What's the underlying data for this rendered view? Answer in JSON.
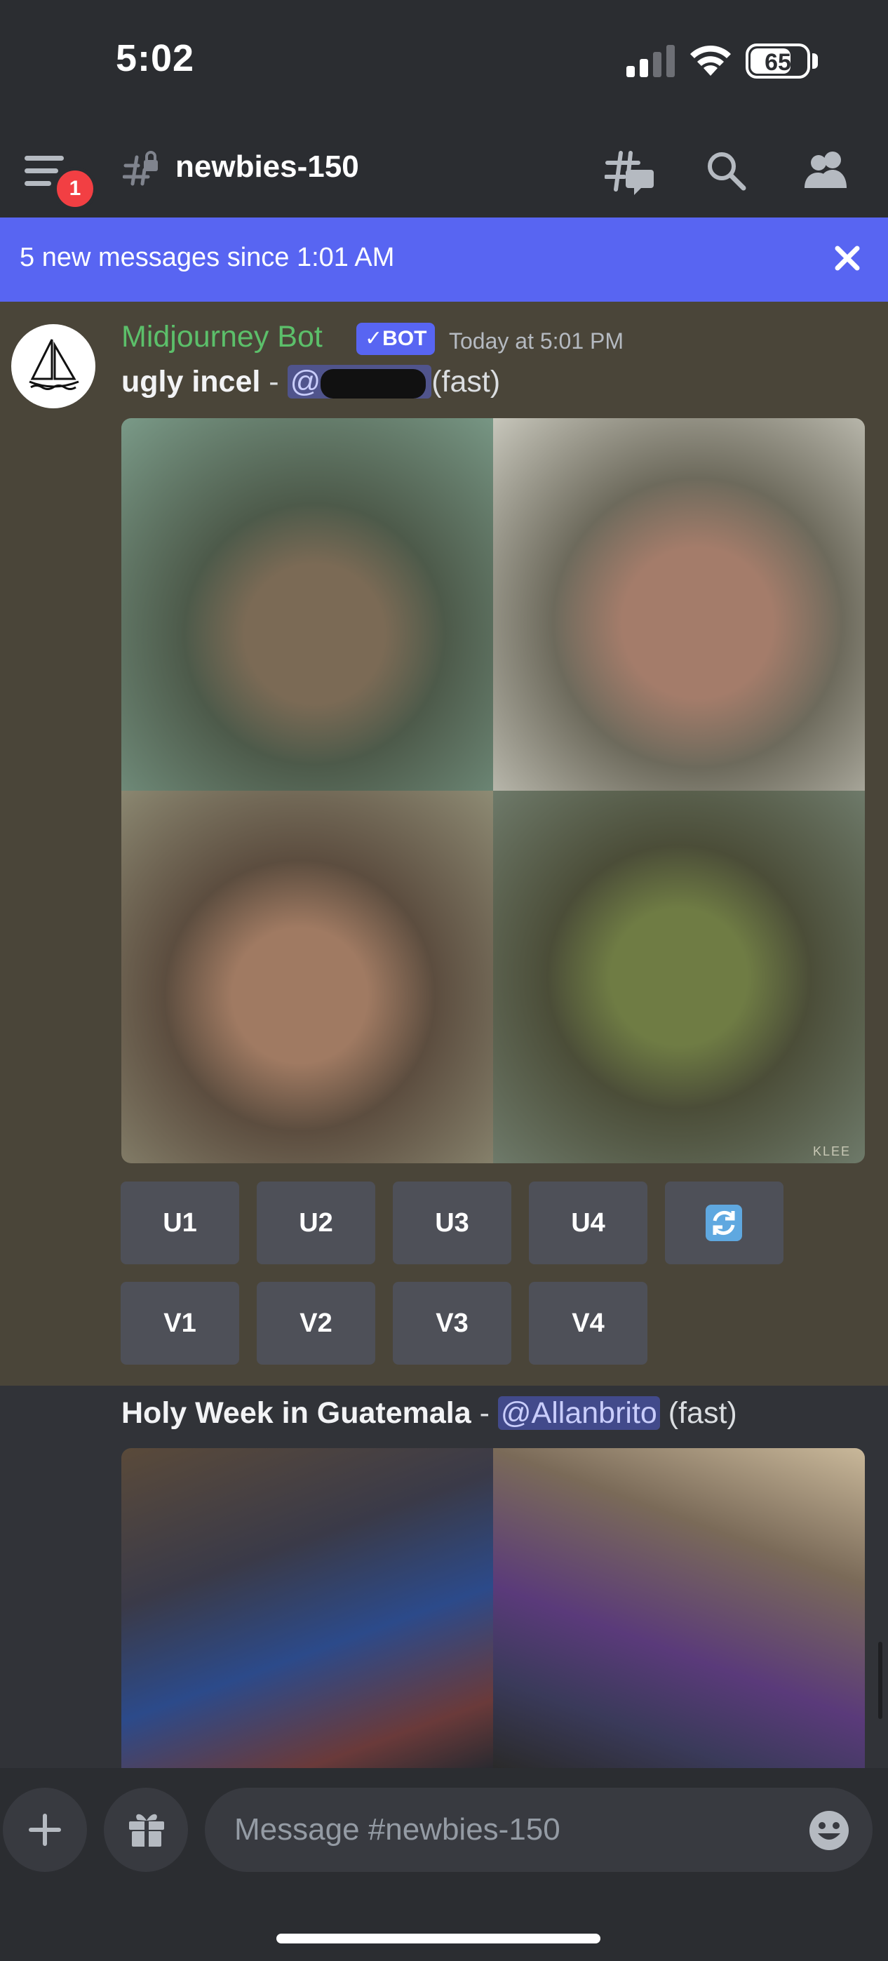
{
  "status_bar": {
    "time": "5:02",
    "battery": "65"
  },
  "header": {
    "channel": "newbies-150",
    "notification_count": "1"
  },
  "banner": {
    "text": "5 new messages since 1:01 AM"
  },
  "message1": {
    "author": "Midjourney Bot",
    "bot_tag": "BOT",
    "timestamp": "Today at 5:01 PM",
    "prompt": "ugly incel",
    "separator": " - ",
    "mention": "@",
    "speed": "(fast)",
    "buttons_row1": [
      "U1",
      "U2",
      "U3",
      "U4"
    ],
    "buttons_row2": [
      "V1",
      "V2",
      "V3",
      "V4"
    ],
    "image_signature": "KLEE"
  },
  "message2": {
    "prompt": "Holy Week in Guatemala",
    "separator": " - ",
    "mention": "@Allanbrito",
    "speed": " (fast)"
  },
  "composer": {
    "placeholder": "Message #newbies-150"
  },
  "colors": {
    "blurple": "#5865f2",
    "bot_name": "#5cbf6a",
    "badge_red": "#f23f43"
  }
}
